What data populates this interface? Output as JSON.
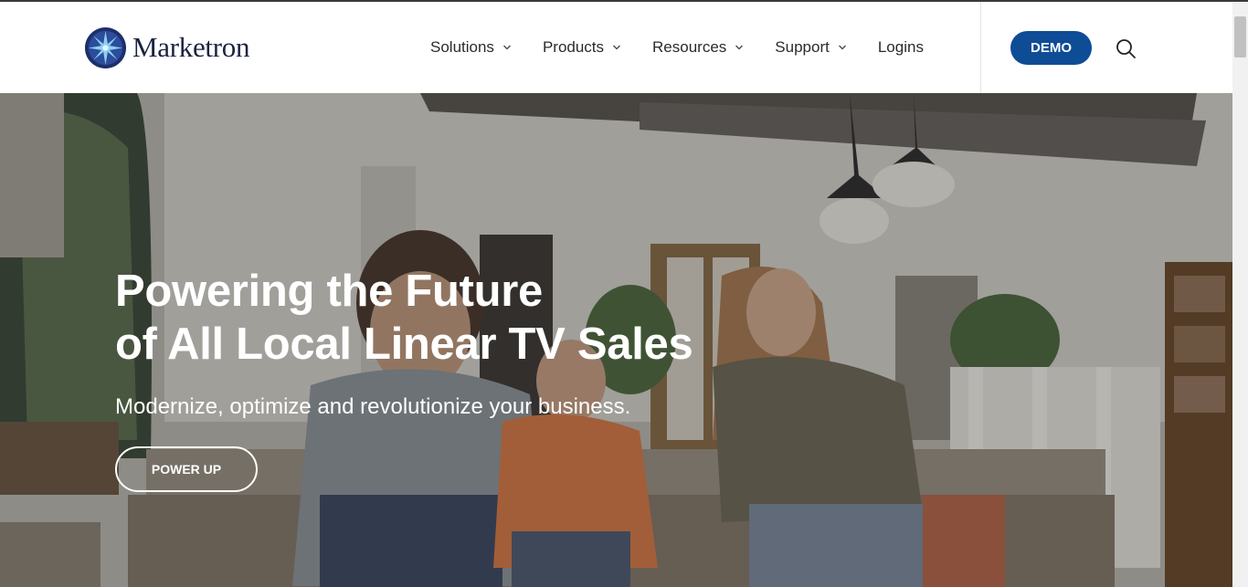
{
  "brand": {
    "name": "Marketron",
    "logo_icon": "star-burst-logo-icon",
    "logo_color": "#1c2340"
  },
  "nav": {
    "items": [
      {
        "label": "Solutions",
        "has_dropdown": true
      },
      {
        "label": "Products",
        "has_dropdown": true
      },
      {
        "label": "Resources",
        "has_dropdown": true
      },
      {
        "label": "Support",
        "has_dropdown": true
      },
      {
        "label": "Logins",
        "has_dropdown": false
      }
    ]
  },
  "header": {
    "demo_label": "DEMO",
    "search_icon": "search-icon",
    "accent_color": "#0f4c96"
  },
  "hero": {
    "title_line1": "Powering the Future",
    "title_line2": "of All Local Linear TV Sales",
    "subtitle": "Modernize, optimize and revolutionize your business.",
    "cta_label": "POWER UP"
  }
}
